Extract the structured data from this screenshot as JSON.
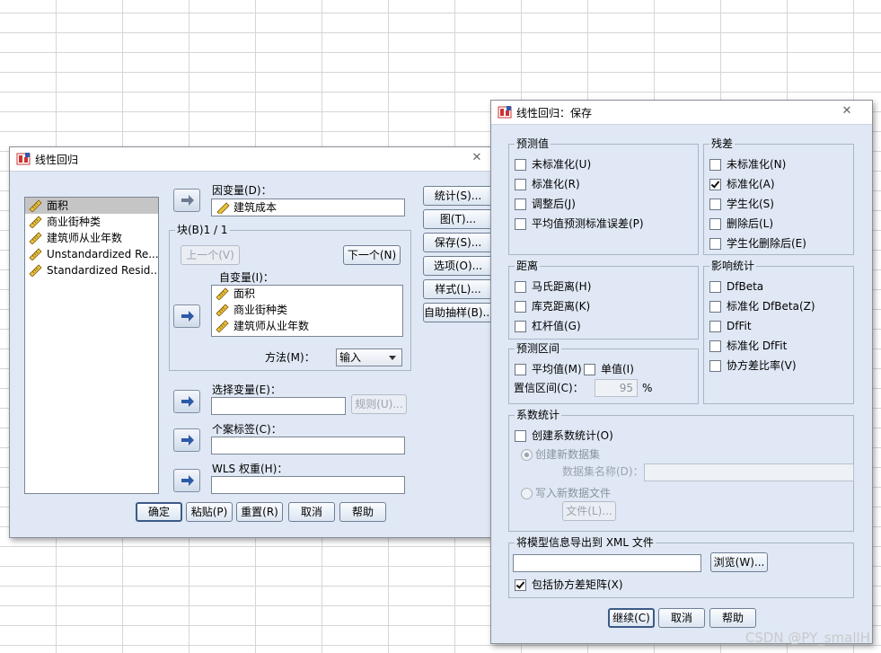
{
  "main_dialog": {
    "title": "线性回归",
    "source_vars": [
      "面积",
      "商业街种类",
      "建筑师从业年数",
      "Unstandardized Re...",
      "Standardized Resid..."
    ],
    "dependent_label": "因变量(D)：",
    "dependent_value": "建筑成本",
    "block_label": "块(B)1 / 1",
    "prev_btn": "上一个(V)",
    "next_btn": "下一个(N)",
    "independent_label": "自变量(I)：",
    "independent_vars": [
      "面积",
      "商业街种类",
      "建筑师从业年数"
    ],
    "method_label": "方法(M)：",
    "method_value": "输入",
    "selection_label": "选择变量(E)：",
    "rule_btn": "规则(U)...",
    "case_label": "个案标签(C)：",
    "wls_label": "WLS 权重(H)：",
    "side_buttons": [
      "统计(S)...",
      "图(T)...",
      "保存(S)...",
      "选项(O)...",
      "样式(L)...",
      "自助抽样(B)..."
    ],
    "bottom_buttons": [
      "确定",
      "粘贴(P)",
      "重置(R)",
      "取消",
      "帮助"
    ]
  },
  "save_dialog": {
    "title": "线性回归：保存",
    "predicted": {
      "title": "预测值",
      "items": [
        {
          "label": "未标准化(U)",
          "checked": false
        },
        {
          "label": "标准化(R)",
          "checked": false
        },
        {
          "label": "调整后(J)",
          "checked": false
        },
        {
          "label": "平均值预测标准误差(P)",
          "checked": false
        }
      ]
    },
    "residuals": {
      "title": "残差",
      "items": [
        {
          "label": "未标准化(N)",
          "checked": false
        },
        {
          "label": "标准化(A)",
          "checked": true
        },
        {
          "label": "学生化(S)",
          "checked": false
        },
        {
          "label": "删除后(L)",
          "checked": false
        },
        {
          "label": "学生化删除后(E)",
          "checked": false
        }
      ]
    },
    "distances": {
      "title": "距离",
      "items": [
        {
          "label": "马氏距离(H)",
          "checked": false
        },
        {
          "label": "库克距离(K)",
          "checked": false
        },
        {
          "label": "杠杆值(G)",
          "checked": false
        }
      ]
    },
    "influence": {
      "title": "影响统计",
      "items": [
        {
          "label": "DfBeta",
          "checked": false
        },
        {
          "label": "标准化 DfBeta(Z)",
          "checked": false
        },
        {
          "label": "DfFit",
          "checked": false
        },
        {
          "label": "标准化 DfFit",
          "checked": false
        },
        {
          "label": "协方差比率(V)",
          "checked": false
        }
      ]
    },
    "pred_interval": {
      "title": "预测区间",
      "mean": "平均值(M)",
      "individual": "单值(I)",
      "ci_label": "置信区间(C)：",
      "ci_value": "95",
      "percent": "%"
    },
    "coef": {
      "title": "系数统计",
      "create": "创建系数统计(O)",
      "new_dataset": "创建新数据集",
      "dataset_name": "数据集名称(D)：",
      "write_file": "写入新数据文件",
      "file_btn": "文件(L)..."
    },
    "export": {
      "title": "将模型信息导出到 XML 文件",
      "browse": "浏览(W)...",
      "include_cov": "包括协方差矩阵(X)",
      "include_checked": true
    },
    "buttons": [
      "继续(C)",
      "取消",
      "帮助"
    ]
  },
  "watermark": "CSDN @PY_smallH"
}
